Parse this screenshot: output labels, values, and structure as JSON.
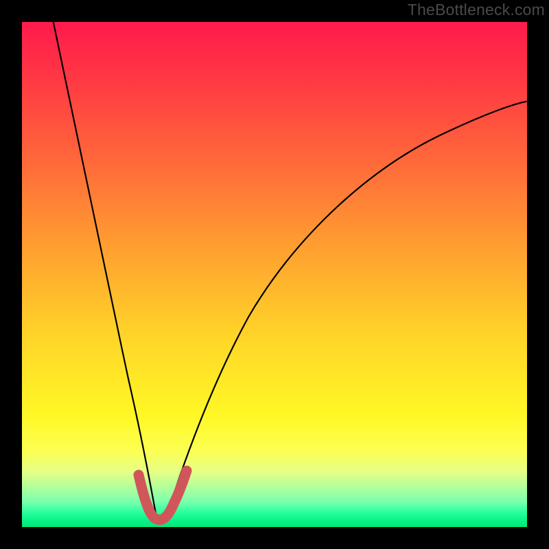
{
  "watermark": "TheBottleneck.com",
  "colors": {
    "frame": "#000000",
    "curve": "#000000",
    "highlight": "#d1565a",
    "gradient_top": "#ff1a4c",
    "gradient_bottom": "#03e879"
  },
  "chart_data": {
    "type": "line",
    "title": "",
    "xlabel": "",
    "ylabel": "",
    "xlim": [
      0,
      100
    ],
    "ylim": [
      0,
      100
    ],
    "grid": false,
    "legend": false,
    "series": [
      {
        "name": "curve",
        "x": [
          0,
          2,
          4,
          6,
          8,
          10,
          12,
          14,
          16,
          18,
          20,
          22,
          23,
          24,
          25,
          26,
          27,
          28,
          29,
          30,
          32,
          34,
          36,
          40,
          45,
          50,
          55,
          60,
          65,
          70,
          75,
          80,
          85,
          90,
          95,
          100
        ],
        "y": [
          100,
          92,
          84,
          76,
          68,
          60,
          51,
          43,
          34,
          26,
          17,
          9,
          6,
          4,
          3,
          2,
          2,
          3,
          5,
          8,
          14,
          20,
          25,
          35,
          45,
          52,
          59,
          64,
          68,
          72,
          75,
          78,
          80,
          82,
          83,
          84
        ]
      },
      {
        "name": "highlight",
        "x": [
          22,
          23,
          24,
          25,
          26,
          27,
          28,
          29
        ],
        "y": [
          9,
          6,
          4,
          3,
          2,
          2,
          3,
          5
        ]
      }
    ]
  }
}
